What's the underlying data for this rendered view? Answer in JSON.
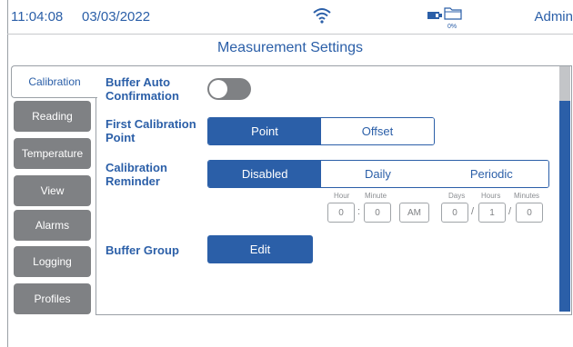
{
  "status": {
    "time": "11:04:08",
    "date": "03/03/2022",
    "storage_percent": "0%",
    "user": "Admin",
    "icons": [
      "wifi-icon",
      "battery-icon",
      "folder-icon"
    ]
  },
  "title": "Measurement Settings",
  "tabs": [
    {
      "label": "Calibration",
      "active": true
    },
    {
      "label": "Reading"
    },
    {
      "label": "Temperature"
    },
    {
      "label": "View"
    },
    {
      "label": "Alarms"
    },
    {
      "label": "Logging"
    },
    {
      "label": "Profiles"
    }
  ],
  "settings": {
    "buffer_auto_confirmation": {
      "label": "Buffer Auto Confirmation",
      "value": "off"
    },
    "first_calibration_point": {
      "label": "First Calibration Point",
      "options": [
        "Point",
        "Offset"
      ],
      "selected": "Point"
    },
    "calibration_reminder": {
      "label": "Calibration Reminder",
      "options": [
        "Disabled",
        "Daily",
        "Periodic"
      ],
      "selected": "Disabled",
      "time_labels": {
        "hour": "Hour",
        "minute": "Minute"
      },
      "time_values": {
        "hour": "0",
        "minute": "0",
        "ampm": "AM"
      },
      "period_labels": {
        "days": "Days",
        "hours": "Hours",
        "minutes": "Minutes"
      },
      "period_values": {
        "days": "0",
        "hours": "1",
        "minutes": "0"
      },
      "separators": {
        "colon": ":",
        "slash": "/"
      }
    },
    "buffer_group": {
      "label": "Buffer Group",
      "button": "Edit"
    }
  },
  "colors": {
    "accent": "#2b5fa8",
    "inactive_tab": "#7f8184",
    "border": "#9aa0a6"
  }
}
